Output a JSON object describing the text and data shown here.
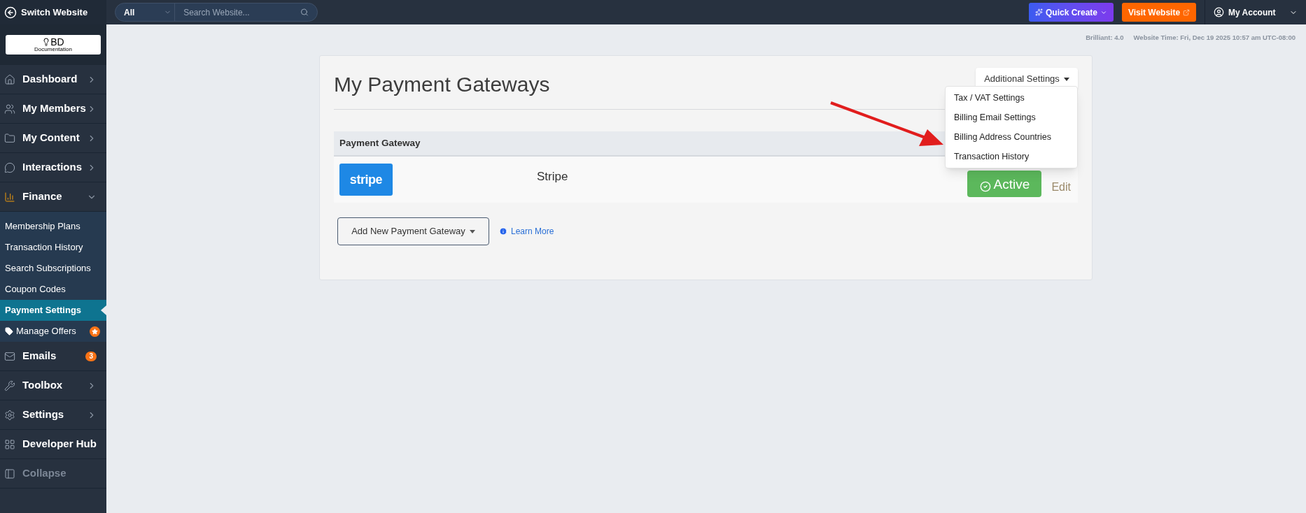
{
  "topbar": {
    "switch_label": "Switch Website",
    "search_scope": "All",
    "search_placeholder": "Search Website...",
    "quick_create": "Quick Create",
    "visit_website": "Visit Website",
    "account": "My Account"
  },
  "sidebar": {
    "logo": {
      "title": "BD",
      "subtitle": "Documentation"
    },
    "items": [
      {
        "label": "Dashboard",
        "kind": "nav",
        "expanded": false
      },
      {
        "label": "My Members",
        "kind": "nav",
        "expanded": false
      },
      {
        "label": "My Content",
        "kind": "nav",
        "expanded": false
      },
      {
        "label": "Interactions",
        "kind": "nav",
        "expanded": false
      },
      {
        "label": "Finance",
        "kind": "nav",
        "expanded": true,
        "children": [
          {
            "label": "Membership Plans",
            "selected": false
          },
          {
            "label": "Transaction History",
            "selected": false
          },
          {
            "label": "Search Subscriptions",
            "selected": false
          },
          {
            "label": "Coupon Codes",
            "selected": false
          },
          {
            "label": "Payment Settings",
            "selected": true
          },
          {
            "label": "Manage Offers",
            "selected": false,
            "kind": "offer"
          }
        ]
      },
      {
        "label": "Emails",
        "kind": "badge",
        "badge": "3"
      },
      {
        "label": "Toolbox",
        "kind": "nav",
        "expanded": false
      },
      {
        "label": "Settings",
        "kind": "nav",
        "expanded": false
      },
      {
        "label": "Developer Hub",
        "kind": "plain"
      },
      {
        "label": "Collapse",
        "kind": "muted"
      }
    ]
  },
  "meta": {
    "version": "Brilliant: 4.0",
    "time": "Website Time: Fri, Dec 19 2025 10:57 am UTC-08:00"
  },
  "card": {
    "title": "My Payment Gateways",
    "settings_button": "Additional Settings",
    "menu": [
      "Tax / VAT Settings",
      "Billing Email Settings",
      "Billing Address Countries",
      "Transaction History"
    ],
    "table": {
      "columns": [
        "Payment Gateway"
      ],
      "rows": [
        {
          "logo": "stripe",
          "name": "Stripe",
          "status": "Active",
          "action": "Edit"
        }
      ]
    },
    "add_button": "Add New Payment Gateway",
    "learn_more": "Learn More"
  }
}
